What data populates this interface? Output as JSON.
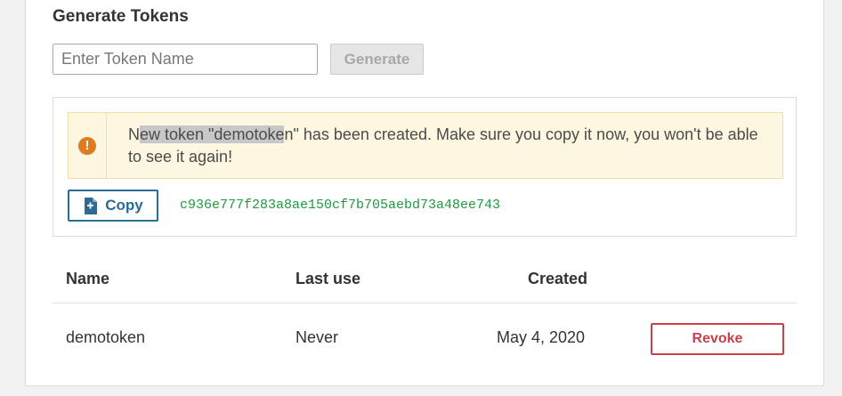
{
  "section": {
    "title": "Generate Tokens"
  },
  "form": {
    "input_placeholder": "Enter Token Name",
    "input_value": "",
    "generate_label": "Generate"
  },
  "alert": {
    "icon": "exclamation-circle-icon",
    "message_prefix": "N",
    "message_selected": "ew token \"demotoke",
    "message_suffix": "n\" has been created. Make sure you copy it now, you won't be able to see it again!",
    "color": "#fdf6e0",
    "icon_color": "#de7b1f"
  },
  "copy": {
    "label": "Copy",
    "icon": "document-copy-icon",
    "token": "c936e777f283a8ae150cf7b705aebd73a48ee743"
  },
  "table": {
    "headers": {
      "name": "Name",
      "last_use": "Last use",
      "created": "Created"
    },
    "rows": [
      {
        "name": "demotoken",
        "last_use": "Never",
        "created": "May 4, 2020",
        "action": "Revoke"
      }
    ]
  }
}
